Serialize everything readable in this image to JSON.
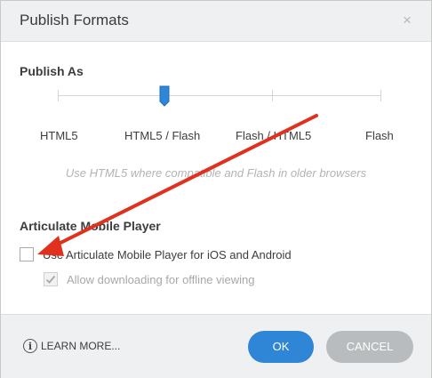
{
  "dialog": {
    "title": "Publish Formats",
    "close_glyph": "×"
  },
  "publish_as": {
    "heading": "Publish As",
    "options": [
      "HTML5",
      "HTML5 / Flash",
      "Flash / HTML5",
      "Flash"
    ],
    "selected_index": 1,
    "hint": "Use HTML5 where compatible and Flash in older browsers"
  },
  "mobile": {
    "heading": "Articulate Mobile Player",
    "use_mobile_player": {
      "label": "Use Articulate Mobile Player for iOS and Android",
      "checked": false
    },
    "allow_offline": {
      "label": "Allow downloading for offline viewing",
      "checked": true,
      "enabled": false
    }
  },
  "footer": {
    "learn_more": "LEARN MORE...",
    "info_glyph": "i",
    "ok_label": "OK",
    "cancel_label": "CANCEL"
  },
  "colors": {
    "accent": "#2f86d6",
    "annotation_arrow": "#e0301e",
    "thumb": "#2f86d6"
  },
  "icons": [
    "close-icon",
    "info-icon",
    "slider-thumb",
    "annotation-arrow"
  ]
}
